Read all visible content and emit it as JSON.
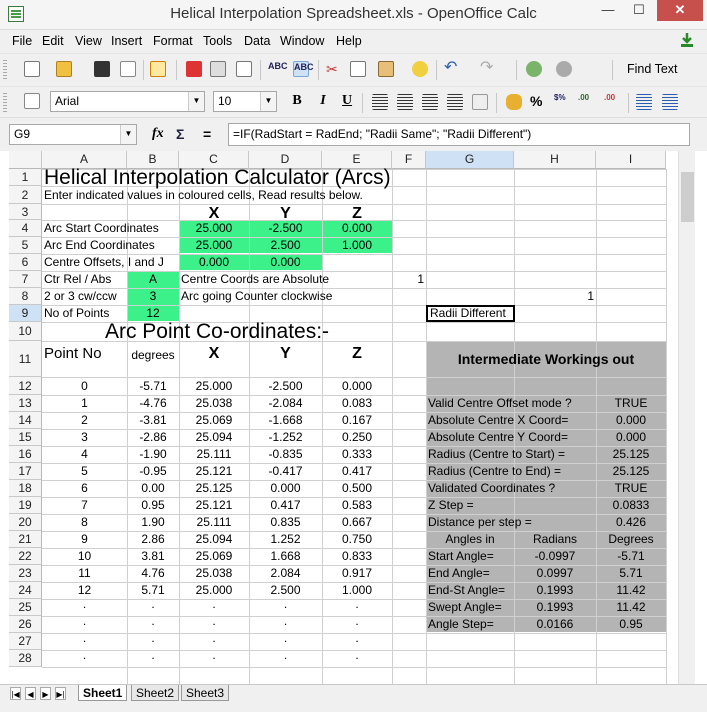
{
  "window": {
    "title": "Helical Interpolation Spreadsheet.xls - OpenOffice Calc",
    "min_glyph": "—",
    "max_glyph": "☐",
    "close_glyph": "✕"
  },
  "menu": [
    "File",
    "Edit",
    "View",
    "Insert",
    "Format",
    "Tools",
    "Data",
    "Window",
    "Help"
  ],
  "toolbar": {
    "find_text": "Find Text",
    "font_name": "Arial",
    "font_size": "10",
    "bold": "B",
    "italic": "I",
    "underline": "U"
  },
  "formula_bar": {
    "name_box": "G9",
    "formula": "=IF(RadStart = RadEnd; \"Radii Same\"; \"Radii Different\")",
    "fx": "fx",
    "sigma": "Σ",
    "equals": "="
  },
  "columns": [
    "A",
    "B",
    "C",
    "D",
    "E",
    "F",
    "G",
    "H",
    "I"
  ],
  "rows": [
    "1",
    "2",
    "3",
    "4",
    "5",
    "6",
    "7",
    "8",
    "9",
    "10",
    "11",
    "12",
    "13",
    "14",
    "15",
    "16",
    "17",
    "18",
    "19",
    "20",
    "21",
    "22",
    "23",
    "24",
    "25",
    "26",
    "27",
    "28"
  ],
  "sheet": {
    "title": "Helical Interpolation Calculator (Arcs)",
    "instruction": "Enter indicated values in coloured cells, Read results below.",
    "hdr_x": "X",
    "hdr_y": "Y",
    "hdr_z": "Z",
    "arc_start_label": "Arc Start Coordinates",
    "arc_start_x": "25.000",
    "arc_start_y": "-2.500",
    "arc_start_z": "0.000",
    "arc_end_label": "Arc End Coordinates",
    "arc_end_x": "25.000",
    "arc_end_y": "2.500",
    "arc_end_z": "1.000",
    "centre_offsets_label": "Centre Offsets, I and J",
    "centre_i": "0.000",
    "centre_j": "0.000",
    "ctr_mode_label": "Ctr Rel / Abs",
    "ctr_mode_value": "A",
    "ctr_mode_desc": "Centre Coords are Absolute",
    "ctr_mode_flag": "1",
    "direction_label": "2 or 3 cw/ccw",
    "direction_value": "3",
    "direction_desc": "Arc going Counter clockwise",
    "direction_flag": "1",
    "points_label": "No of Points",
    "points_value": "12",
    "radii_check": "Radii Different",
    "arc_points_title": "Arc Point Co-ordinates:-",
    "col_point_no": "Point No",
    "col_degrees": "degrees",
    "col_x": "X",
    "col_y": "Y",
    "col_z": "Z",
    "points": [
      {
        "n": "0",
        "deg": "-5.71",
        "x": "25.000",
        "y": "-2.500",
        "z": "0.000"
      },
      {
        "n": "1",
        "deg": "-4.76",
        "x": "25.038",
        "y": "-2.084",
        "z": "0.083"
      },
      {
        "n": "2",
        "deg": "-3.81",
        "x": "25.069",
        "y": "-1.668",
        "z": "0.167"
      },
      {
        "n": "3",
        "deg": "-2.86",
        "x": "25.094",
        "y": "-1.252",
        "z": "0.250"
      },
      {
        "n": "4",
        "deg": "-1.90",
        "x": "25.111",
        "y": "-0.835",
        "z": "0.333"
      },
      {
        "n": "5",
        "deg": "-0.95",
        "x": "25.121",
        "y": "-0.417",
        "z": "0.417"
      },
      {
        "n": "6",
        "deg": "0.00",
        "x": "25.125",
        "y": "0.000",
        "z": "0.500"
      },
      {
        "n": "7",
        "deg": "0.95",
        "x": "25.121",
        "y": "0.417",
        "z": "0.583"
      },
      {
        "n": "8",
        "deg": "1.90",
        "x": "25.111",
        "y": "0.835",
        "z": "0.667"
      },
      {
        "n": "9",
        "deg": "2.86",
        "x": "25.094",
        "y": "1.252",
        "z": "0.750"
      },
      {
        "n": "10",
        "deg": "3.81",
        "x": "25.069",
        "y": "1.668",
        "z": "0.833"
      },
      {
        "n": "11",
        "deg": "4.76",
        "x": "25.038",
        "y": "2.084",
        "z": "0.917"
      },
      {
        "n": "12",
        "deg": "5.71",
        "x": "25.000",
        "y": "2.500",
        "z": "1.000"
      }
    ],
    "dot": ".",
    "workings_title": "Intermediate Workings out",
    "workings": [
      {
        "label": "Valid Centre Offset mode ?",
        "value": "TRUE"
      },
      {
        "label": "Absolute Centre X Coord=",
        "value": "0.000"
      },
      {
        "label": "Absolute Centre Y Coord=",
        "value": "0.000"
      },
      {
        "label": "Radius (Centre to Start) =",
        "value": "25.125"
      },
      {
        "label": "Radius (Centre to End) =",
        "value": "25.125"
      },
      {
        "label": "Validated Coordinates ?",
        "value": "TRUE"
      },
      {
        "label": "Z Step =",
        "value": "0.0833"
      },
      {
        "label": "Distance per step =",
        "value": "0.426"
      }
    ],
    "angles_hdr": {
      "a": "Angles in",
      "b": "Radians",
      "c": "Degrees"
    },
    "angles": [
      {
        "label": "Start Angle=",
        "rad": "-0.0997",
        "deg": "-5.71"
      },
      {
        "label": "End Angle=",
        "rad": "0.0997",
        "deg": "5.71"
      },
      {
        "label": "End-St Angle=",
        "rad": "0.1993",
        "deg": "11.42"
      },
      {
        "label": "Swept Angle=",
        "rad": "0.1993",
        "deg": "11.42"
      },
      {
        "label": "Angle Step=",
        "rad": "0.0166",
        "deg": "0.95"
      }
    ]
  },
  "tabs": [
    "Sheet1",
    "Sheet2",
    "Sheet3"
  ]
}
